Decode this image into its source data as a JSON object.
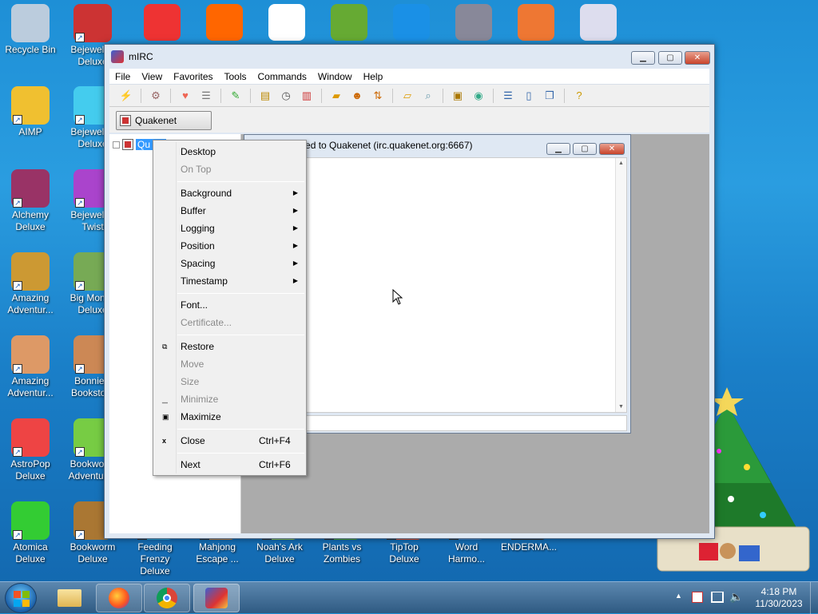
{
  "desktop": {
    "icons": [
      {
        "label": "Recycle Bin",
        "icon": "recycle-bin-icon"
      },
      {
        "label": "Bejeweled Deluxe",
        "icon": "bejeweled-icon"
      },
      {
        "label": "AIMP",
        "icon": "aimp-icon"
      },
      {
        "label": "Bejeweled Deluxe",
        "icon": "bejeweled-gem-icon"
      },
      {
        "label": "Alchemy Deluxe",
        "icon": "alchemy-icon"
      },
      {
        "label": "Bejeweled Twist",
        "icon": "bejeweled-twist-icon"
      },
      {
        "label": "Amazing Adventur...",
        "icon": "amazing-adventures-icon"
      },
      {
        "label": "Big Money Deluxe",
        "icon": "big-money-icon"
      },
      {
        "label": "Amazing Adventur...",
        "icon": "amazing-adventures-2-icon"
      },
      {
        "label": "Bonnie's Bookstore",
        "icon": "bonnie-icon"
      },
      {
        "label": "AstroPop Deluxe",
        "icon": "astropop-icon"
      },
      {
        "label": "Bookworm Adventures",
        "icon": "bookworm-adventures-icon"
      },
      {
        "label": "Atomica Deluxe",
        "icon": "atomica-icon"
      },
      {
        "label": "Bookworm Deluxe",
        "icon": "bookworm-icon"
      },
      {
        "label": "Feeding Frenzy Deluxe",
        "icon": "feeding-frenzy-icon"
      },
      {
        "label": "Mahjong Escape ...",
        "icon": "mahjong-icon"
      },
      {
        "label": "Noah's Ark Deluxe",
        "icon": "noahs-ark-icon"
      },
      {
        "label": "Plants vs Zombies",
        "icon": "pvz-icon"
      },
      {
        "label": "TipTop Deluxe",
        "icon": "tiptop-icon"
      },
      {
        "label": "Word Harmo...",
        "icon": "word-harmony-icon"
      },
      {
        "label": "ENDERMA...",
        "icon": "enderman-icon"
      }
    ]
  },
  "mirc": {
    "title": "mIRC",
    "menu": [
      "File",
      "View",
      "Favorites",
      "Tools",
      "Commands",
      "Window",
      "Help"
    ],
    "switchbar_label": "Quakenet",
    "tree_label": "Qu",
    "status_window_title": "Not connected to Quakenet (irc.quakenet.org:6667)",
    "context_menu": {
      "desktop": "Desktop",
      "ontop": "On Top",
      "background": "Background",
      "buffer": "Buffer",
      "logging": "Logging",
      "position": "Position",
      "spacing": "Spacing",
      "timestamp": "Timestamp",
      "font": "Font...",
      "certificate": "Certificate...",
      "restore": "Restore",
      "move": "Move",
      "size": "Size",
      "minimize": "Minimize",
      "maximize": "Maximize",
      "close": "Close",
      "close_shortcut": "Ctrl+F4",
      "next": "Next",
      "next_shortcut": "Ctrl+F6"
    }
  },
  "taskbar": {
    "time": "4:18 PM",
    "date": "11/30/2023"
  }
}
